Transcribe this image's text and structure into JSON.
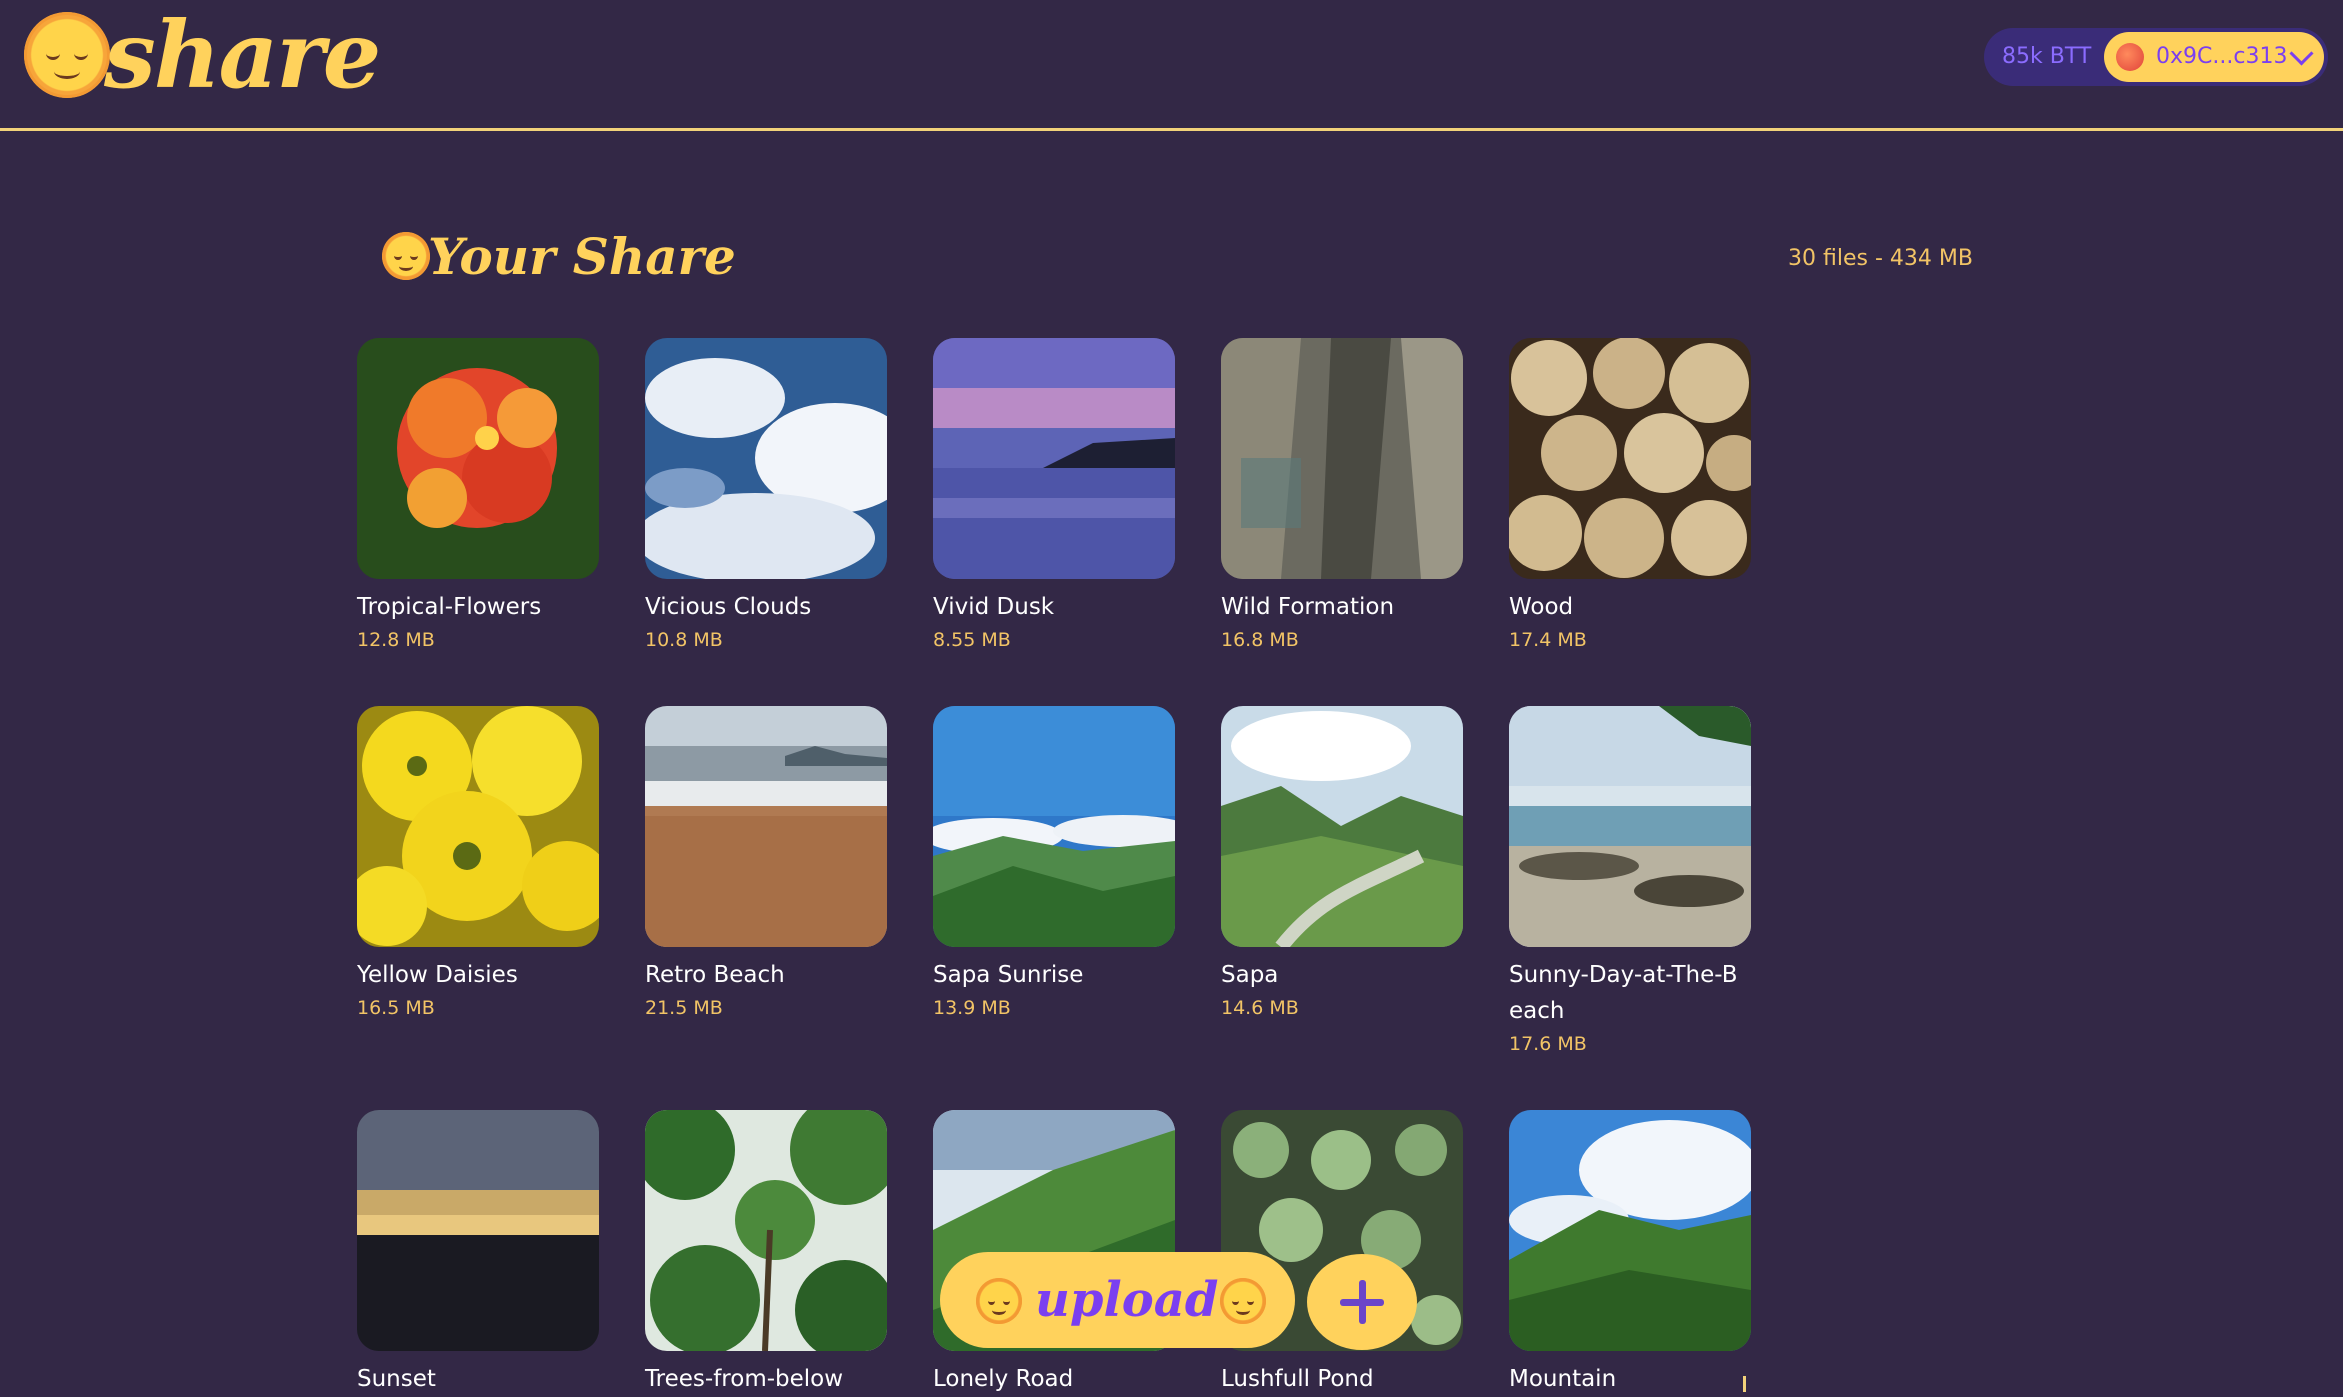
{
  "app": {
    "name": "share"
  },
  "wallet": {
    "balance": "85k BTT",
    "address": "0x9C...c313"
  },
  "page": {
    "title": "Your Share",
    "stats": "30 files - 434 MB"
  },
  "files": [
    {
      "name": "Tropical-Flowers",
      "size": "12.8 MB",
      "scene": "flowers-red"
    },
    {
      "name": "Vicious Clouds",
      "size": "10.8 MB",
      "scene": "clouds"
    },
    {
      "name": "Vivid Dusk",
      "size": "8.55 MB",
      "scene": "dusk"
    },
    {
      "name": "Wild Formation",
      "size": "16.8 MB",
      "scene": "rock"
    },
    {
      "name": "Wood",
      "size": "17.4 MB",
      "scene": "wood"
    },
    {
      "name": "Yellow Daisies",
      "size": "16.5 MB",
      "scene": "daisies"
    },
    {
      "name": "Retro Beach",
      "size": "21.5 MB",
      "scene": "beach"
    },
    {
      "name": "Sapa Sunrise",
      "size": "13.9 MB",
      "scene": "sapa-sunrise"
    },
    {
      "name": "Sapa",
      "size": "14.6 MB",
      "scene": "sapa"
    },
    {
      "name": "Sunny-Day-at-The-Beach",
      "size": "17.6 MB",
      "scene": "sunny-beach"
    },
    {
      "name": "Sunset",
      "size": "",
      "scene": "sunset"
    },
    {
      "name": "Trees-from-below",
      "size": "",
      "scene": "trees"
    },
    {
      "name": "Lonely Road",
      "size": "",
      "scene": "road"
    },
    {
      "name": "Lushfull Pond",
      "size": "",
      "scene": "pond"
    },
    {
      "name": "Mountain",
      "size": "",
      "scene": "mountain"
    }
  ],
  "upload": {
    "label": "upload"
  },
  "colors": {
    "background": "#332846",
    "accent": "#ffd25c",
    "purple": "#7b3ff0",
    "size_text": "#f2c466"
  },
  "icons": [
    "sun-logo-icon",
    "chevron-down-icon",
    "plus-icon"
  ]
}
